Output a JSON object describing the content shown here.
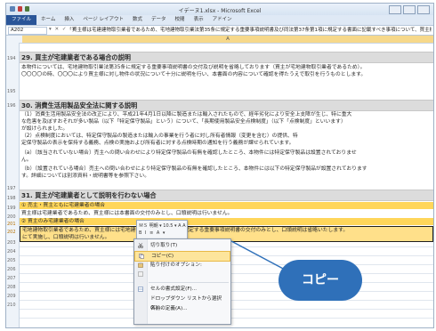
{
  "window": {
    "title": "イデーヌ1.xlsx - Microsoft Excel"
  },
  "ribbon": {
    "tabs": [
      "ファイル",
      "ホーム",
      "挿入",
      "ページ レイアウト",
      "数式",
      "データ",
      "校閲",
      "表示",
      "アドイン"
    ]
  },
  "formula_bar": {
    "name_box": "A202",
    "fx_icons": "▾ ✕ ✓ fx",
    "formula": "買主様は宅建建物取引業者であるため、宅地建物取引業法第35条に規定する重要事項説明書及び同法第37条第1項に規定する書面に記載すべき事項について、買主様には本書"
  },
  "column_header": "A",
  "rows": {
    "numbers": [
      "194",
      "195",
      "196",
      "197",
      "198",
      "199",
      "200",
      "201",
      "202",
      "203",
      "204",
      "205",
      "206",
      "207",
      "208",
      "209",
      "210"
    ]
  },
  "sections": [
    {
      "heading": "29. 買主が宅建業者である場合の説明",
      "lines": [
        "本物件については、宅地建物取引業法第35条に規定する重要事項説明書の交付及び説明を省略しております（買主が宅地建物取引業者であるため）。",
        "〇〇〇〇の時、〇〇〇により買主様に対し物件の状況について十分に説明を行い、本書面の内容について確認を得たうえで取引を行うものとします。"
      ]
    },
    {
      "heading": "30. 消費生活用製品安全法に関する説明",
      "lines": [
        "（1）消費生活用製品安全法の改正により、平成21年4月1日以降に製造または輸入されたもので、経年劣化により安全上支障が生じ、特に重大",
        "な危害を及ぼすおそれが多い製品（以下「特定保守製品」という）について、「長期使用製品安全点検制度」（以下「点検制度」といいます）",
        "が設けられました。",
        "（2）点検制度においては、特定保守製品の製造または輸入の事業を行う者に対し所有者情報（変更を含む）の提供、特",
        "定保守製品の表示を保持する義務、点検の実施および所有者に対する点検時期の通知を行う義務が課せられています。",
        "（a）〔該当されていない場合〕売主への問い合わせにより特定保守製品の有無を確認したところ、本物件には特定保守製品は設置されておりませ",
        "ん。",
        "（b）〔設置されている場合〕売主への問い合わせにより特定保守製品の有無を確認したところ、本物件には以下の特定保守製品が設置されております",
        "す。詳細については別添資料・説明書等を参照下さい。"
      ]
    },
    {
      "heading": "31. 買主が宅建業者として説明を行わない場合",
      "lines": [
        "① 売主・買主ともに宅建業者の場合",
        "買主様は宅建業者であるため、買主様には本書面の交付のみとし、口頭説明は行いません。",
        "② 買主のみ宅建業者の場合",
        "宅地建物取引業者であるため、買主様には宅地建物取引業法第35条に規定する重要事項説明書の交付のみとし、口頭説明は省略いたします。",
        "にて実施し、口頭説明は行いません。"
      ]
    }
  ],
  "mini_toolbar": {
    "row1": "ＭＳ 明朝 ▾ 10.5 ▾ A A",
    "row2": "B I ≡ A ▾"
  },
  "context_menu": {
    "items": [
      "切り取り(T)",
      "コピー(C)",
      "貼り付けのオプション:",
      "",
      "セルの書式設定(F)...",
      "ドロップダウン リストから選択(K)...",
      "名前の定義(A)..."
    ],
    "hover_index": 1
  },
  "callout": {
    "label": "コピー"
  }
}
